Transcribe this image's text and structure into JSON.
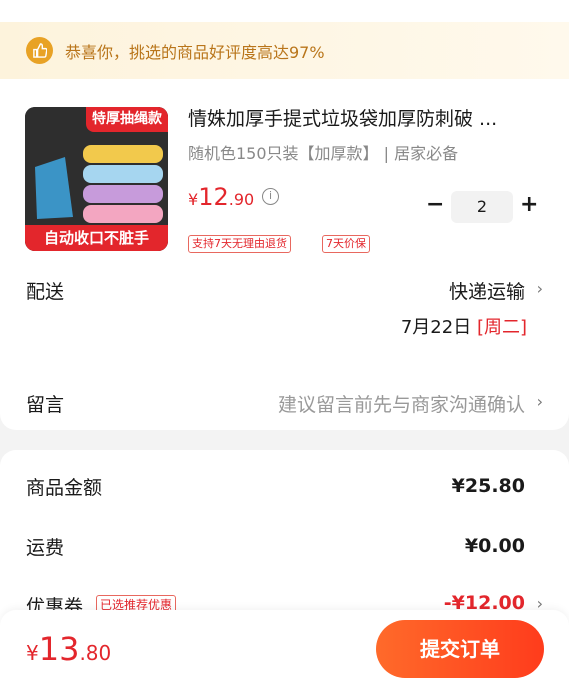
{
  "banner": {
    "text": "恭喜你，挑选的商品好评度高达97%"
  },
  "product": {
    "thumb_top_label": "特厚抽绳款",
    "thumb_bottom_label": "自动收口不脏手",
    "title": "情姝加厚手提式垃圾袋加厚防刺破 ...",
    "spec": "随机色150只装【加厚款】 | 居家必备",
    "price_currency": "¥",
    "price_int": "12",
    "price_dec": ".90",
    "quantity": "2",
    "tags": [
      "支持7天无理由退货",
      "7天价保"
    ]
  },
  "delivery": {
    "label": "配送",
    "method": "快递运输",
    "date": "7月22日",
    "weekday": "[周二]"
  },
  "message": {
    "label": "留言",
    "placeholder": "建议留言前先与商家沟通确认"
  },
  "summary": {
    "goods_label": "商品金额",
    "goods_value": "¥25.80",
    "freight_label": "运费",
    "freight_value": "¥0.00",
    "coupon_label": "优惠券",
    "coupon_tag": "已选推荐优惠",
    "coupon_value": "-¥12.00"
  },
  "footer": {
    "total_currency": "¥",
    "total_int": "13",
    "total_dec": ".80",
    "submit_label": "提交订单"
  },
  "colors": {
    "accent": "#e3262c",
    "submit": "#ff4a20",
    "banner_text": "#b9751a"
  }
}
